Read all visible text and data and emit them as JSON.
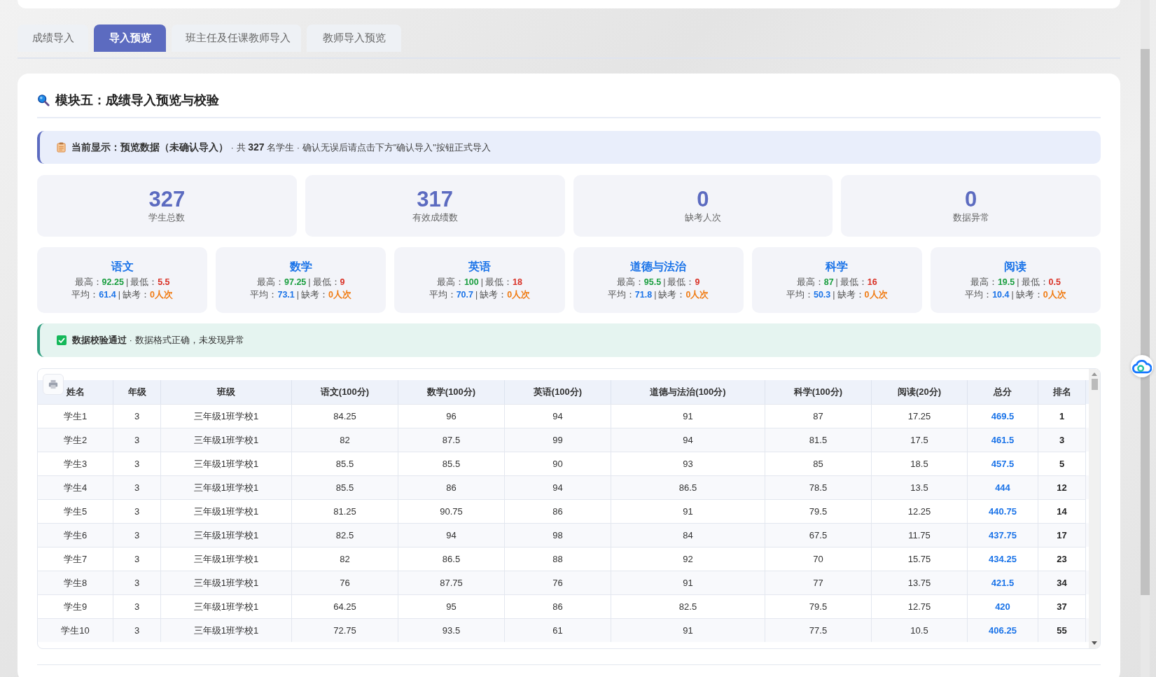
{
  "tabs": [
    {
      "label": "成绩导入",
      "selected": false
    },
    {
      "label": "导入预览",
      "selected": true
    },
    {
      "label": "班主任及任课教师导入",
      "selected": false
    },
    {
      "label": "教师导入预览",
      "selected": false
    }
  ],
  "module": {
    "title": "模块五：成绩导入预览与校验"
  },
  "notice": "**当前显示：预览数据（未确认导入）** · 共 **327** 名学生 · 确认无误后请点击下方\"确认导入\"按钮正式导入",
  "stats": [
    {
      "value": "327",
      "label": "学生总数"
    },
    {
      "value": "317",
      "label": "有效成绩数"
    },
    {
      "value": "0",
      "label": "缺考人次"
    },
    {
      "value": "0",
      "label": "数据异常"
    }
  ],
  "subjects": [
    {
      "name": "语文",
      "lines": [
        {
          "sep": "|",
          "items": [
            {
              "label": "最高：",
              "value": "92.25",
              "kind": "high"
            },
            {
              "label": "最低：",
              "value": "5.5",
              "kind": "low"
            }
          ]
        },
        {
          "sep": "|",
          "items": [
            {
              "label": "平均：",
              "value": "61.4",
              "kind": "avg"
            },
            {
              "label": "缺考：",
              "value": "0人次",
              "kind": "absent"
            }
          ]
        }
      ]
    },
    {
      "name": "数学",
      "lines": [
        {
          "sep": "|",
          "items": [
            {
              "label": "最高：",
              "value": "97.25",
              "kind": "high"
            },
            {
              "label": "最低：",
              "value": "9",
              "kind": "low"
            }
          ]
        },
        {
          "sep": "|",
          "items": [
            {
              "label": "平均：",
              "value": "73.1",
              "kind": "avg"
            },
            {
              "label": "缺考：",
              "value": "0人次",
              "kind": "absent"
            }
          ]
        }
      ]
    },
    {
      "name": "英语",
      "lines": [
        {
          "sep": "|",
          "items": [
            {
              "label": "最高：",
              "value": "100",
              "kind": "high"
            },
            {
              "label": "最低：",
              "value": "18",
              "kind": "low"
            }
          ]
        },
        {
          "sep": "|",
          "items": [
            {
              "label": "平均：",
              "value": "70.7",
              "kind": "avg"
            },
            {
              "label": "缺考：",
              "value": "0人次",
              "kind": "absent"
            }
          ]
        }
      ]
    },
    {
      "name": "道德与法治",
      "lines": [
        {
          "sep": "|",
          "items": [
            {
              "label": "最高：",
              "value": "95.5",
              "kind": "high"
            },
            {
              "label": "最低：",
              "value": "9",
              "kind": "low"
            }
          ]
        },
        {
          "sep": "|",
          "items": [
            {
              "label": "平均：",
              "value": "71.8",
              "kind": "avg"
            },
            {
              "label": "缺考：",
              "value": "0人次",
              "kind": "absent"
            }
          ]
        }
      ]
    },
    {
      "name": "科学",
      "lines": [
        {
          "sep": "|",
          "items": [
            {
              "label": "最高：",
              "value": "87",
              "kind": "high"
            },
            {
              "label": "最低：",
              "value": "16",
              "kind": "low"
            }
          ]
        },
        {
          "sep": "|",
          "items": [
            {
              "label": "平均：",
              "value": "50.3",
              "kind": "avg"
            },
            {
              "label": "缺考：",
              "value": "0人次",
              "kind": "absent"
            }
          ]
        }
      ]
    },
    {
      "name": "阅读",
      "lines": [
        {
          "sep": "|",
          "items": [
            {
              "label": "最高：",
              "value": "19.5",
              "kind": "high"
            },
            {
              "label": "最低：",
              "value": "0.5",
              "kind": "low"
            }
          ]
        },
        {
          "sep": "|",
          "items": [
            {
              "label": "平均：",
              "value": "10.4",
              "kind": "avg"
            },
            {
              "label": "缺考：",
              "value": "0人次",
              "kind": "absent"
            }
          ]
        }
      ]
    }
  ],
  "validation": {
    "passed": true,
    "text": "**数据校验通过** · 数据格式正确，未发现异常"
  },
  "table": {
    "columns": [
      {
        "label": "姓名",
        "kind": "text"
      },
      {
        "label": "年级",
        "kind": "text"
      },
      {
        "label": "班级",
        "kind": "text"
      },
      {
        "label": "语文(100分)",
        "kind": "text"
      },
      {
        "label": "数学(100分)",
        "kind": "text"
      },
      {
        "label": "英语(100分)",
        "kind": "text"
      },
      {
        "label": "道德与法治(100分)",
        "kind": "text"
      },
      {
        "label": "科学(100分)",
        "kind": "text"
      },
      {
        "label": "阅读(20分)",
        "kind": "text"
      },
      {
        "label": "总分",
        "kind": "total"
      },
      {
        "label": "排名",
        "kind": "rank"
      }
    ],
    "rows": [
      [
        "学生1",
        "3",
        "三年级1班学校1",
        "84.25",
        "96",
        "94",
        "91",
        "87",
        "17.25",
        "469.5",
        "1"
      ],
      [
        "学生2",
        "3",
        "三年级1班学校1",
        "82",
        "87.5",
        "99",
        "94",
        "81.5",
        "17.5",
        "461.5",
        "3"
      ],
      [
        "学生3",
        "3",
        "三年级1班学校1",
        "85.5",
        "85.5",
        "90",
        "93",
        "85",
        "18.5",
        "457.5",
        "5"
      ],
      [
        "学生4",
        "3",
        "三年级1班学校1",
        "85.5",
        "86",
        "94",
        "86.5",
        "78.5",
        "13.5",
        "444",
        "12"
      ],
      [
        "学生5",
        "3",
        "三年级1班学校1",
        "81.25",
        "90.75",
        "86",
        "91",
        "79.5",
        "12.25",
        "440.75",
        "14"
      ],
      [
        "学生6",
        "3",
        "三年级1班学校1",
        "82.5",
        "94",
        "98",
        "84",
        "67.5",
        "11.75",
        "437.75",
        "17"
      ],
      [
        "学生7",
        "3",
        "三年级1班学校1",
        "82",
        "86.5",
        "88",
        "92",
        "70",
        "15.75",
        "434.25",
        "23"
      ],
      [
        "学生8",
        "3",
        "三年级1班学校1",
        "76",
        "87.75",
        "76",
        "91",
        "77",
        "13.75",
        "421.5",
        "34"
      ],
      [
        "学生9",
        "3",
        "三年级1班学校1",
        "64.25",
        "95",
        "86",
        "82.5",
        "79.5",
        "12.75",
        "420",
        "37"
      ],
      [
        "学生10",
        "3",
        "三年级1班学校1",
        "72.75",
        "93.5",
        "61",
        "91",
        "77.5",
        "10.5",
        "406.25",
        "55"
      ]
    ]
  }
}
